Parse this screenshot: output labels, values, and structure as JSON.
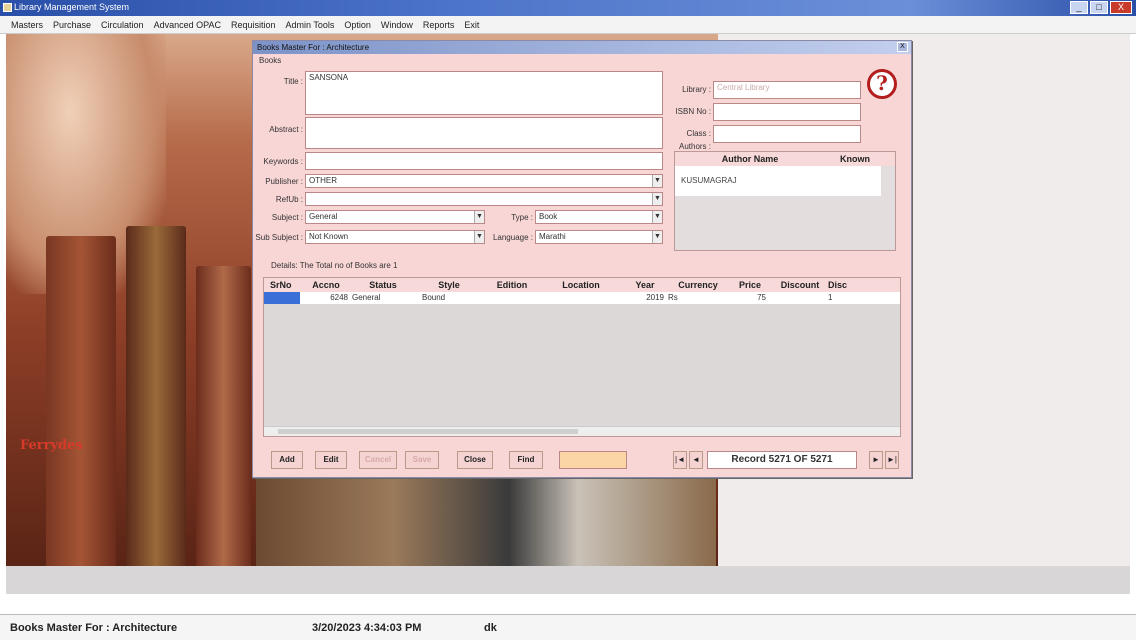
{
  "app": {
    "title": "Library Management System"
  },
  "window_buttons": {
    "minimize": "_",
    "maximize": "□",
    "close": "X"
  },
  "menu": [
    "Masters",
    "Purchase",
    "Circulation",
    "Advanced OPAC",
    "Requisition",
    "Admin Tools",
    "Option",
    "Window",
    "Reports",
    "Exit"
  ],
  "dialog": {
    "title": "Books Master For : Architecture",
    "close": "X",
    "section_label": "Books",
    "fields": {
      "title": {
        "label": "Title :",
        "value": "SANSONA"
      },
      "abstract": {
        "label": "Abstract :",
        "value": ""
      },
      "keywords": {
        "label": "Keywords :",
        "value": ""
      },
      "publisher": {
        "label": "Publisher :",
        "value": "OTHER"
      },
      "ref_ub": {
        "label": "RefUb :",
        "value": ""
      },
      "subject": {
        "label": "Subject :",
        "value": "General"
      },
      "type": {
        "label": "Type :",
        "value": "Book"
      },
      "sub_subject": {
        "label": "Sub Subject :",
        "value": "Not Known"
      },
      "language": {
        "label": "Language :",
        "value": "Marathi"
      },
      "library": {
        "label": "Library :",
        "value": "Central Library"
      },
      "isbn": {
        "label": "ISBN No :",
        "value": ""
      },
      "class": {
        "label": "Class :",
        "value": ""
      },
      "authors_label": "Authors :"
    },
    "help_icon": "?",
    "authors": {
      "columns": [
        "Author Name",
        "Known"
      ],
      "rows": [
        {
          "name": "KUSUMAGRAJ",
          "known": ""
        }
      ]
    },
    "details_label": "Details: The Total no of Books are 1",
    "grid": {
      "columns": [
        "SrNo",
        "Accno",
        "Status",
        "Style",
        "Edition",
        "Location",
        "Year",
        "Currency",
        "Price",
        "Discount",
        "Disc"
      ],
      "rows": [
        {
          "srno": "",
          "accno": "6248",
          "status": "General",
          "style": "Bound",
          "edition": "",
          "location": "",
          "year": "2019",
          "currency": "Rs",
          "price": "75",
          "discount": "",
          "disc": "1"
        }
      ]
    },
    "buttons": {
      "add": "Add",
      "edit": "Edit",
      "cancel": "Cancel",
      "save": "Save",
      "close": "Close",
      "find": "Find"
    },
    "record_info": "Record 5271 OF 5271",
    "nav": {
      "first": "|◄",
      "prev": "◄",
      "next": "►",
      "last": "►|"
    }
  },
  "background": {
    "logo_text": "Ferrydes"
  },
  "status": {
    "form": "Books Master For : Architecture",
    "datetime": "3/20/2023 4:34:03 PM",
    "user": "dk"
  }
}
